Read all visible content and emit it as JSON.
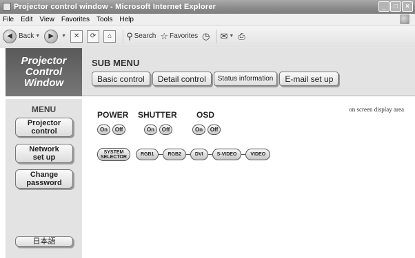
{
  "window": {
    "title": "Projector control window - Microsoft Internet Explorer",
    "buttons": [
      "minimize",
      "maximize",
      "close"
    ]
  },
  "menubar": {
    "items": [
      {
        "label": "File",
        "access": "F"
      },
      {
        "label": "Edit",
        "access": "E"
      },
      {
        "label": "View",
        "access": "V"
      },
      {
        "label": "Favorites",
        "access": "a"
      },
      {
        "label": "Tools",
        "access": "T"
      },
      {
        "label": "Help",
        "access": "H"
      }
    ]
  },
  "toolbar": {
    "back_label": "Back",
    "search_label": "Search",
    "favorites_label": "Favorites",
    "icons": [
      "back-arrow-icon",
      "forward-arrow-icon",
      "stop-icon",
      "refresh-icon",
      "home-icon",
      "search-icon",
      "favorites-star-icon",
      "history-icon",
      "mail-icon",
      "print-icon"
    ]
  },
  "logo": {
    "line1": "Projector",
    "line2": "Control",
    "line3": "Window"
  },
  "submenu": {
    "title": "SUB MENU",
    "buttons": [
      "Basic control",
      "Detail control",
      "Status information",
      "E-mail set up"
    ]
  },
  "sidebar": {
    "title": "MENU",
    "projector_control": [
      "Projector",
      "control"
    ],
    "network_setup": [
      "Network",
      "set up"
    ],
    "change_password": [
      "Change",
      "password"
    ],
    "language": "日本語"
  },
  "main": {
    "osd_area_label": "on screen display area",
    "power": {
      "label": "POWER",
      "on": "On",
      "off": "Off"
    },
    "shutter": {
      "label": "SHUTTER",
      "on": "On",
      "off": "Off"
    },
    "osd": {
      "label": "OSD",
      "on": "On",
      "off": "Off"
    },
    "inputs": {
      "system_selector": [
        "SYSTEM",
        "SELECTOR"
      ],
      "rgb1": "RGB1",
      "rgb2": "RGB2",
      "dvi": "DVI",
      "svideo": "S-VIDEO",
      "video": "VIDEO"
    }
  },
  "colors": {
    "title_bar": "#8a8a8a",
    "panel_bg": "#e3e3e3",
    "logo_bg": "#666666"
  }
}
